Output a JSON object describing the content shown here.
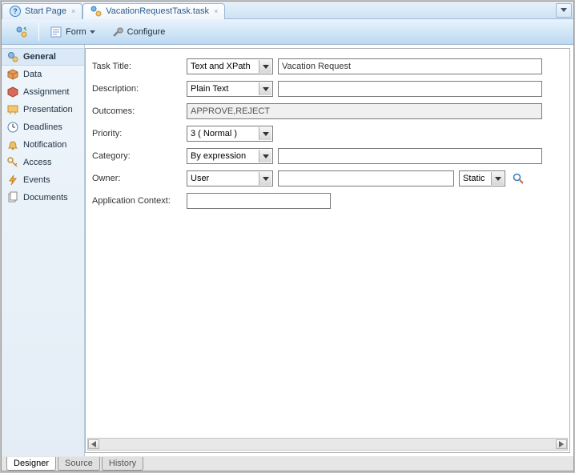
{
  "tabs": {
    "start_page": "Start Page",
    "task_file": "VacationRequestTask.task"
  },
  "toolbar": {
    "form_label": "Form",
    "configure_label": "Configure"
  },
  "sidebar": {
    "items": [
      {
        "label": "General"
      },
      {
        "label": "Data"
      },
      {
        "label": "Assignment"
      },
      {
        "label": "Presentation"
      },
      {
        "label": "Deadlines"
      },
      {
        "label": "Notification"
      },
      {
        "label": "Access"
      },
      {
        "label": "Events"
      },
      {
        "label": "Documents"
      }
    ]
  },
  "form": {
    "task_title_label": "Task Title:",
    "task_title_mode": "Text and XPath",
    "task_title_value": "Vacation Request",
    "description_label": "Description:",
    "description_mode": "Plain Text",
    "description_value": "",
    "outcomes_label": "Outcomes:",
    "outcomes_value": "APPROVE,REJECT",
    "priority_label": "Priority:",
    "priority_value": "3 ( Normal )",
    "category_label": "Category:",
    "category_mode": "By expression",
    "category_value": "",
    "owner_label": "Owner:",
    "owner_mode": "User",
    "owner_value": "",
    "owner_scope": "Static",
    "app_context_label": "Application Context:",
    "app_context_value": ""
  },
  "bottom_tabs": {
    "designer": "Designer",
    "source": "Source",
    "history": "History"
  }
}
